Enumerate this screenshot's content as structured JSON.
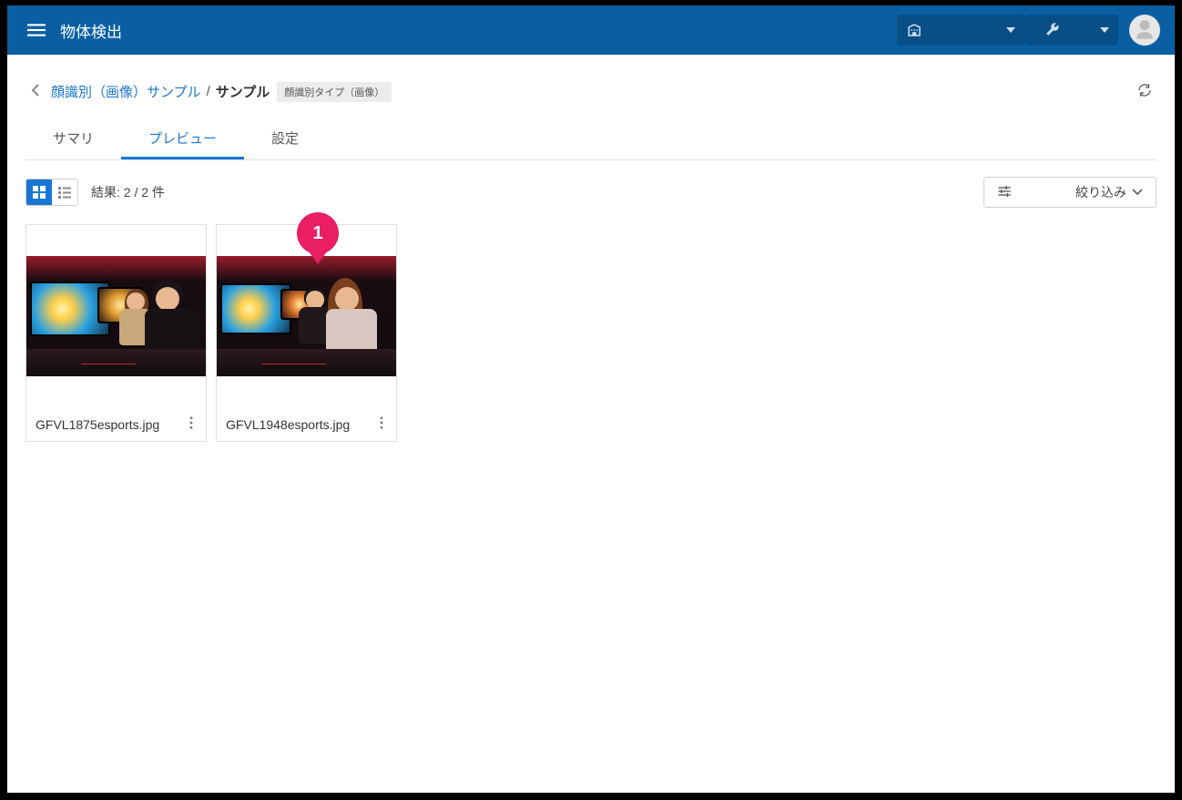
{
  "app": {
    "title": "物体検出"
  },
  "breadcrumb": {
    "parent": "顔識別（画像）サンプル",
    "separator": "/",
    "current": "サンプル",
    "tag": "顔識別タイプ（画像）"
  },
  "tabs": {
    "summary": "サマリ",
    "preview": "プレビュー",
    "settings": "設定",
    "active": "preview"
  },
  "toolbar": {
    "results_prefix": "結果:",
    "results_count": "2 / 2 件",
    "filter_label": "絞り込み"
  },
  "grid": {
    "items": [
      {
        "filename": "GFVL1875esports.jpg"
      },
      {
        "filename": "GFVL1948esports.jpg"
      }
    ]
  },
  "annotation": {
    "pin": "1"
  }
}
